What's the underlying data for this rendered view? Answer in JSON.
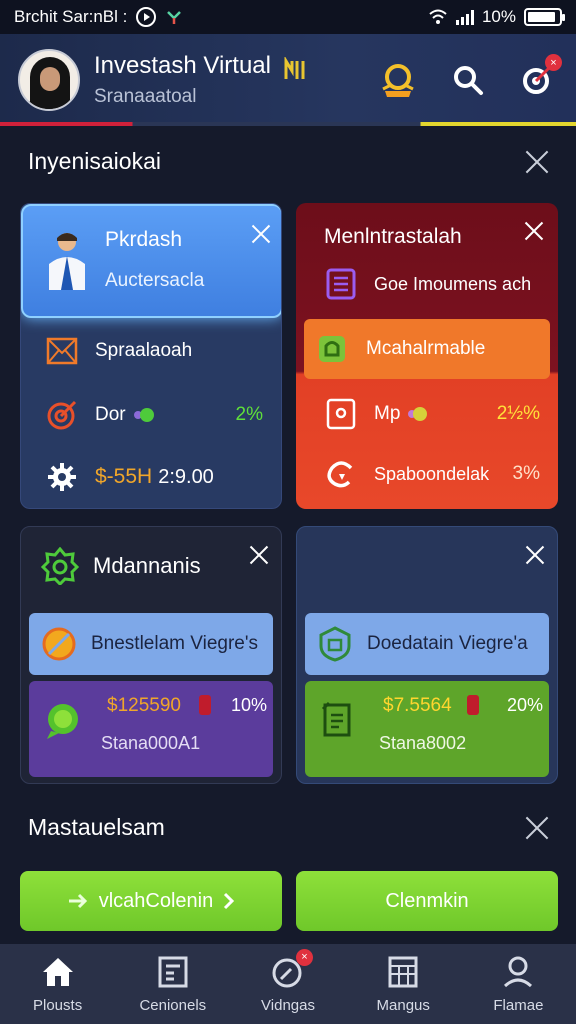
{
  "status_bar": {
    "carrier_text": "Brchit Sar:nBl :",
    "battery": "10%",
    "battery_level": 0.1
  },
  "header": {
    "title": "Investash Virtual",
    "subtitle": "Sranaaatoal",
    "badge_count": "×"
  },
  "section1": {
    "title": "Inyenisaiokai",
    "card_a": {
      "title": "Pkrdash",
      "subtitle": "Auctersacla",
      "row1_label": "Spraalaoah",
      "row2_label": "Dor",
      "row2_pct": "2%",
      "row3_value": "$-55H",
      "row3_time": "2:9.00"
    },
    "card_b": {
      "title": "Menlntrastalah",
      "row1_label": "Goe Imoumens ach",
      "row2_label": "Mcahalrmable",
      "row3_label": "Mp",
      "row3_pct": "2½%",
      "row4_label": "Spaboondelak",
      "row4_pct": "3%"
    }
  },
  "section2": {
    "card_c": {
      "title": "Mdannanis",
      "band1_label": "Bnestlelam Viegre's",
      "amount": "$125590",
      "pct": "10%",
      "code": "Stana000A1"
    },
    "card_d": {
      "band1_label": "Doedatain Viegre'a",
      "amount": "$7.5564",
      "pct": "20%",
      "code": "Stana8002"
    }
  },
  "section3": {
    "title": "Mastauelsam",
    "btn_left": "vlcahColenin",
    "btn_right": "Clenmkin"
  },
  "bottom_nav": {
    "items": [
      {
        "label": "Plousts"
      },
      {
        "label": "Cenionels"
      },
      {
        "label": "Vidngas"
      },
      {
        "label": "Mangus"
      },
      {
        "label": "Flamae"
      }
    ]
  }
}
